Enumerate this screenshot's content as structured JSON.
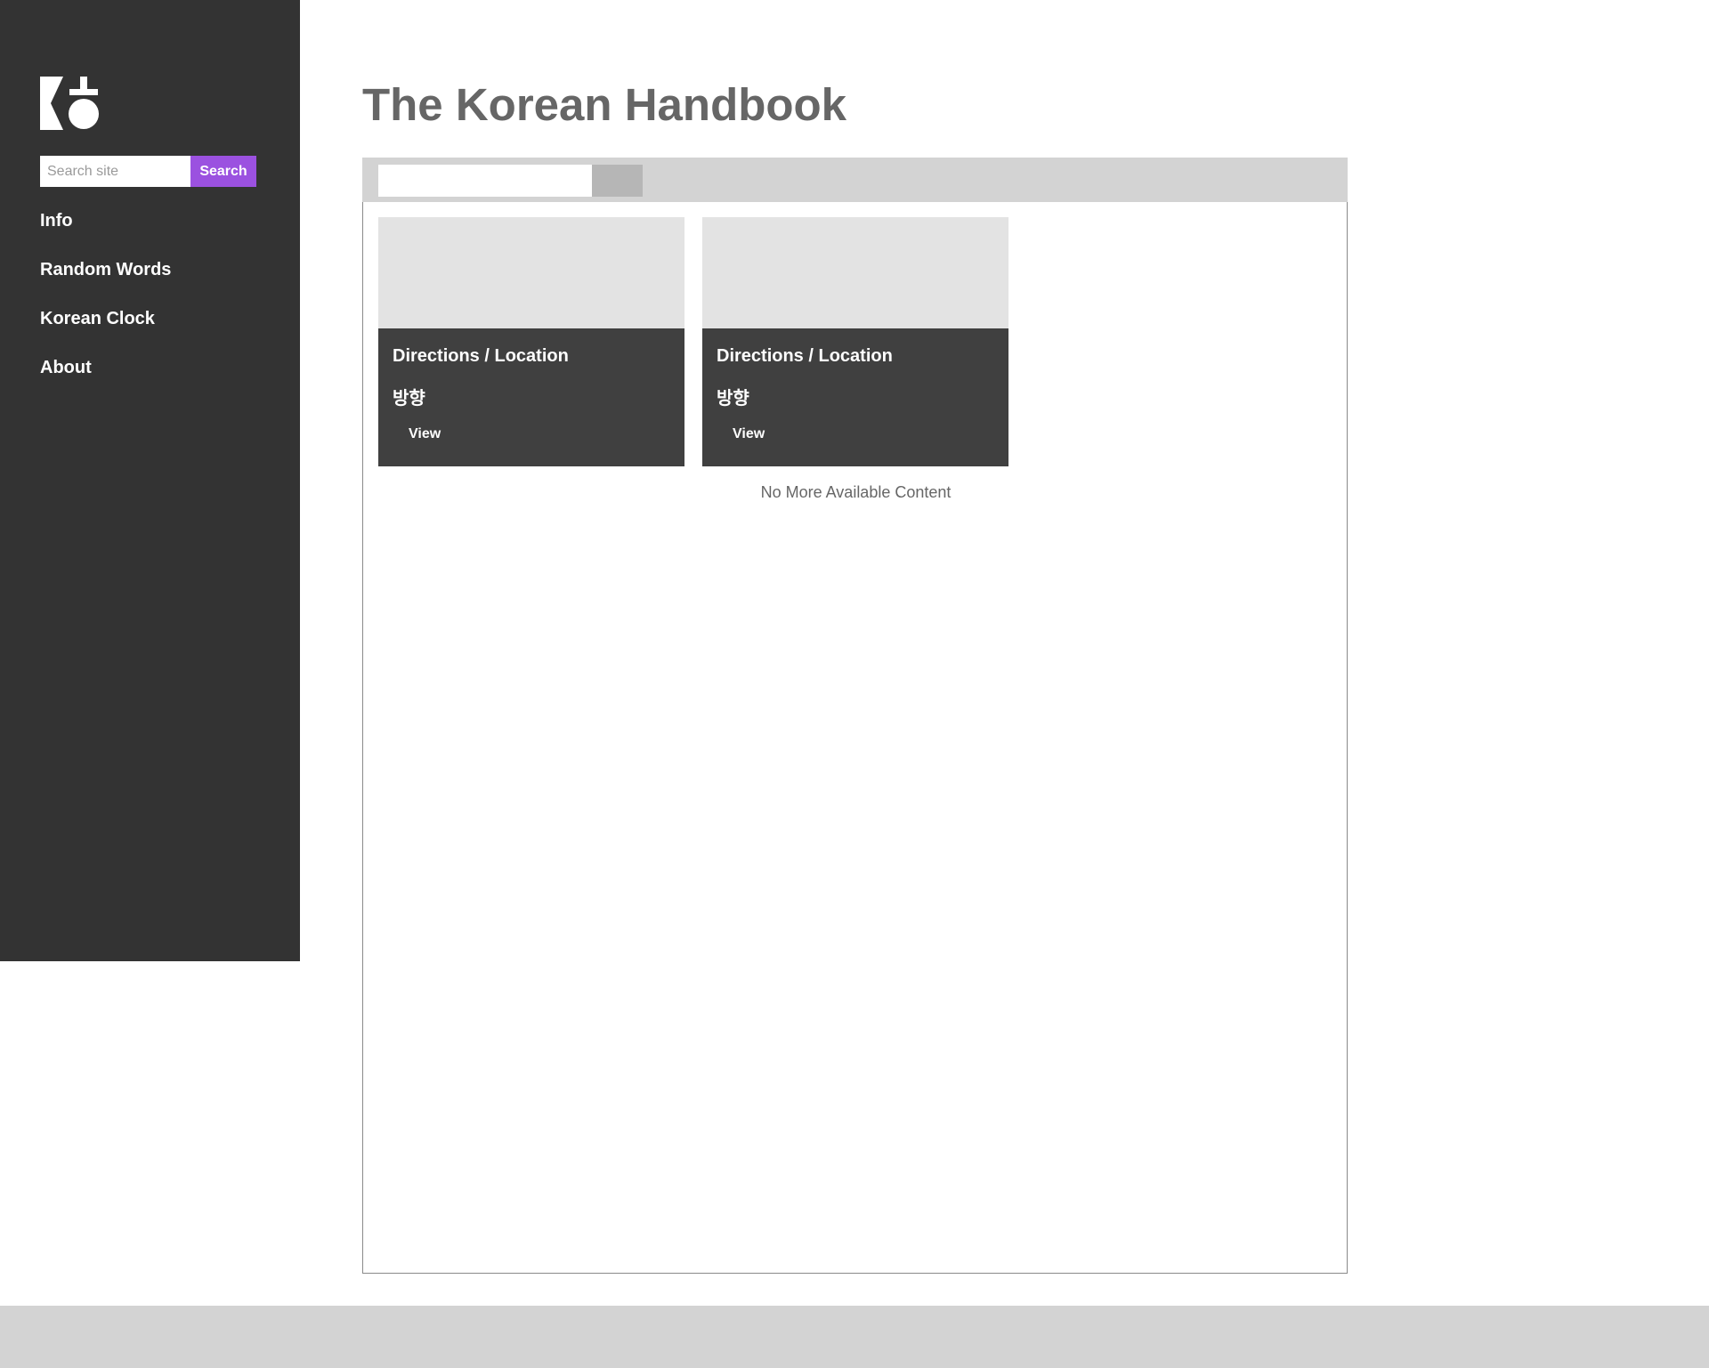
{
  "sidebar": {
    "logo_icon": "korean-hangul-logo-icon",
    "search": {
      "placeholder": "Search site",
      "value": "",
      "button_label": "Search",
      "button_color": "#9b51e0"
    },
    "nav": [
      {
        "label": "Info"
      },
      {
        "label": "Random Words"
      },
      {
        "label": "Korean Clock"
      },
      {
        "label": "About"
      }
    ]
  },
  "main": {
    "title": "The Korean Handbook",
    "panel": {
      "search": {
        "value": "",
        "placeholder": ""
      },
      "cards": [
        {
          "title": "Directions / Location",
          "korean": "방향",
          "action": "View"
        },
        {
          "title": "Directions / Location",
          "korean": "방향",
          "action": "View"
        }
      ],
      "end_message": "No More Available Content"
    }
  },
  "colors": {
    "sidebar_bg": "#333333",
    "card_body_bg": "#404040",
    "card_image_bg": "#e3e3e3",
    "toolbar_bg": "#d3d3d3",
    "title_text": "#666666"
  }
}
